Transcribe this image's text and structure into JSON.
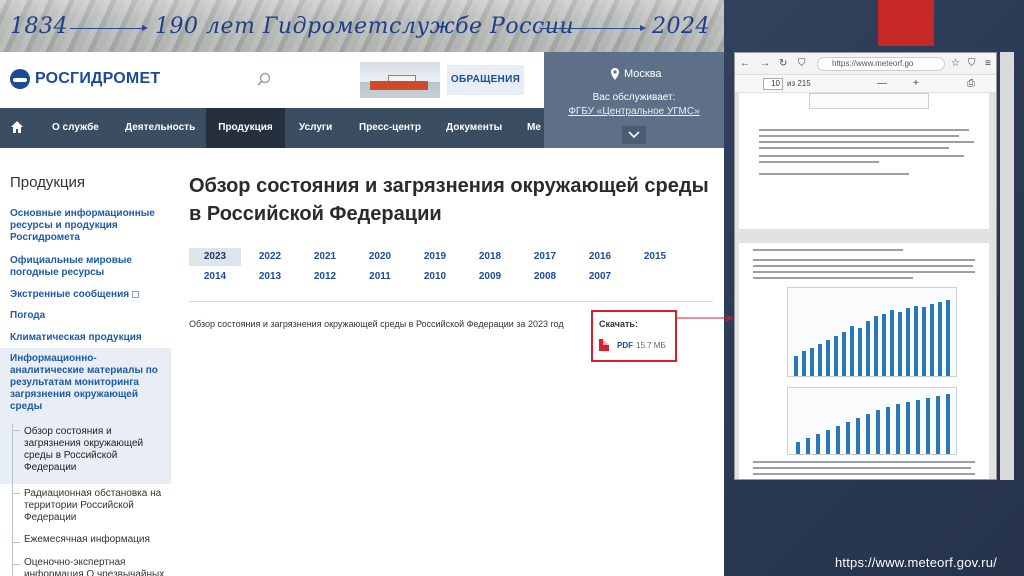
{
  "banner": {
    "year_start": "1834",
    "title": "190 лет Гидрометслужбе России",
    "year_end": "2024"
  },
  "header": {
    "logo": "РОСГИДРОМЕТ",
    "appeal_button": "ОБРАЩЕНИЯ",
    "location": {
      "city": "Москва",
      "served_by": "Вас обслуживает:",
      "organization": "ФГБУ «Центральное УГМС»"
    }
  },
  "nav": {
    "items": [
      "О службе",
      "Деятельность",
      "Продукция",
      "Услуги",
      "Пресс-центр",
      "Документы",
      "Ме"
    ],
    "active": "Продукция"
  },
  "sidebar": {
    "title": "Продукция",
    "links": [
      "Основные информационные ресурсы и продукция Росгидромета",
      "Официальные мировые погодные ресурсы",
      "Экстренные сообщения",
      "Погода",
      "Климатическая продукция",
      "Информационно-аналитические материалы по результатам мониторинга загрязнения окружающей среды"
    ],
    "subitems": [
      "Обзор состояния и загрязнения окружающей среды в Российской Федерации",
      "Радиационная обстановка на территории Российской Федерации",
      "Ежемесячная информация",
      "Оценочно-экспертная информация О чрезвычайных"
    ]
  },
  "main": {
    "title": "Обзор состояния и загрязнения окружающей среды в Российской Федерации",
    "years": [
      "2023",
      "2022",
      "2021",
      "2020",
      "2019",
      "2018",
      "2017",
      "2016",
      "2015",
      "2014",
      "2013",
      "2012",
      "2011",
      "2010",
      "2009",
      "2008",
      "2007"
    ],
    "selected_year": "2023",
    "doc_title": "Обзор состояния и загрязнения окружающей среды в Российской Федерации за 2023 год",
    "download": {
      "label": "Скачать:",
      "format": "PDF",
      "size": "15.7 МБ"
    }
  },
  "viewer": {
    "url": "https://www.meteorf.go",
    "page_current": "10",
    "page_total": "из 215",
    "zoom_minus": "—",
    "zoom_plus": "+"
  },
  "footer_url": "https://www.meteorf.gov.ru/",
  "colors": {
    "brand_blue": "#1d4b9c",
    "nav_bg": "#3c4d62",
    "highlight_red": "#d8202a"
  }
}
